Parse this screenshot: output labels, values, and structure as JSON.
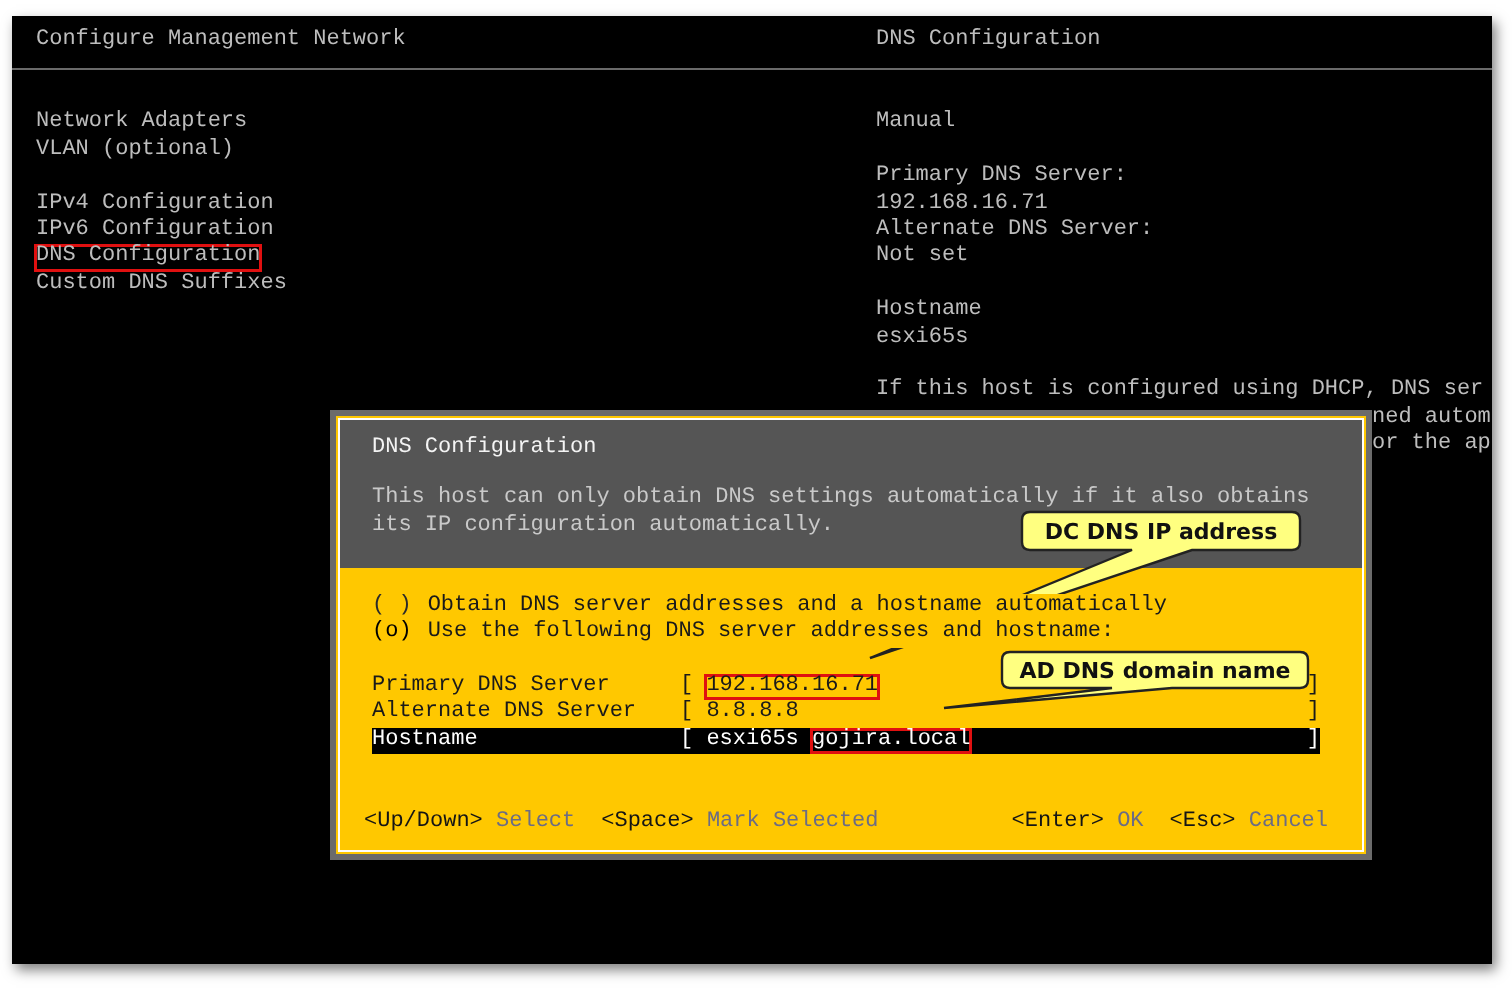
{
  "left_title": "Configure Management Network",
  "right_title": "DNS Configuration",
  "menu_groups": [
    [
      {
        "label": "Network Adapters",
        "highlighted": false
      },
      {
        "label": "VLAN (optional)",
        "highlighted": false
      }
    ],
    [
      {
        "label": "IPv4 Configuration",
        "highlighted": false
      },
      {
        "label": "IPv6 Configuration",
        "highlighted": false
      },
      {
        "label": "DNS Configuration",
        "highlighted": true
      },
      {
        "label": "Custom DNS Suffixes",
        "highlighted": false
      }
    ]
  ],
  "info_blocks": [
    [
      {
        "text": "Manual",
        "kind": "line"
      }
    ],
    [
      {
        "text": "Primary DNS Server:",
        "kind": "line"
      },
      {
        "text": "192.168.16.71",
        "kind": "line"
      },
      {
        "text": "Alternate DNS Server:",
        "kind": "line"
      },
      {
        "text": "Not set",
        "kind": "line"
      }
    ],
    [
      {
        "text": "Hostname",
        "kind": "line"
      },
      {
        "text": "esxi65s",
        "kind": "line"
      }
    ],
    [
      {
        "text": "If this host is configured using DHCP, DNS ser",
        "kind": "line"
      },
      {
        "text": "ned autom",
        "kind": "covered"
      },
      {
        "text": "or the ap",
        "kind": "covered"
      }
    ]
  ],
  "dialog": {
    "title": "DNS Configuration",
    "description_lines": [
      "This host can only obtain DNS settings automatically if it also obtains",
      "its IP configuration automatically."
    ],
    "options": [
      {
        "marker": "( )",
        "label": "Obtain DNS server addresses and a hostname automatically",
        "selected": false
      },
      {
        "marker": "(o)",
        "label": "Use the following DNS server addresses and hostname:",
        "selected": true
      }
    ],
    "fields": [
      {
        "label": "Primary DNS Server",
        "open": "[",
        "parts": [
          {
            "text": "192.168.16.71",
            "highlighted": true
          }
        ],
        "close": "]",
        "focused": false
      },
      {
        "label": "Alternate DNS Server",
        "open": "[",
        "parts": [
          {
            "text": "8.8.8.8",
            "highlighted": false
          }
        ],
        "close": "]",
        "focused": false
      },
      {
        "label": "Hostname",
        "open": "[",
        "parts": [
          {
            "text": "esxi65s",
            "highlighted": false
          },
          {
            "text": "gojira.local",
            "highlighted": true
          }
        ],
        "close": "]",
        "focused": true
      }
    ],
    "footer_left": [
      {
        "key": "<Up/Down>",
        "action": "Select"
      },
      {
        "key": "<Space>",
        "action": "Mark Selected"
      }
    ],
    "footer_right": [
      {
        "key": "<Enter>",
        "action": "OK"
      },
      {
        "key": "<Esc>",
        "action": "Cancel"
      }
    ]
  },
  "callouts": [
    {
      "text": "DC DNS IP address"
    },
    {
      "text": "AD DNS domain name"
    }
  ]
}
